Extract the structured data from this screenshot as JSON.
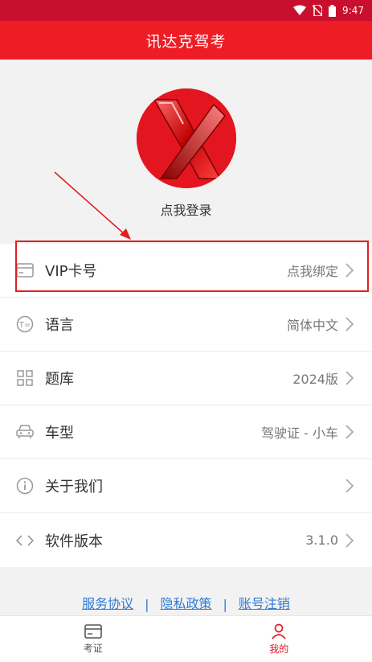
{
  "status_bar": {
    "time": "9:47"
  },
  "app_bar": {
    "title": "讯达克驾考"
  },
  "profile": {
    "login_label": "点我登录"
  },
  "menu": [
    {
      "icon": "card-icon",
      "label": "VIP卡号",
      "value": "点我绑定"
    },
    {
      "icon": "language-icon",
      "label": "语言",
      "value": "简体中文"
    },
    {
      "icon": "grid-icon",
      "label": "题库",
      "value": "2024版"
    },
    {
      "icon": "car-icon",
      "label": "车型",
      "value": "驾驶证 - 小车"
    },
    {
      "icon": "info-icon",
      "label": "关于我们",
      "value": ""
    },
    {
      "icon": "code-icon",
      "label": "软件版本",
      "value": "3.1.0"
    }
  ],
  "footer": {
    "links": [
      "服务协议",
      "隐私政策",
      "账号注销"
    ],
    "separator": "|"
  },
  "bottom_nav": [
    {
      "icon": "id-card-icon",
      "label": "考证",
      "active": false
    },
    {
      "icon": "person-icon",
      "label": "我的",
      "active": true
    }
  ],
  "colors": {
    "brand": "#ee1c25",
    "status_bar": "#c8102e",
    "link": "#2e7bd6",
    "annotation": "#e02020"
  }
}
